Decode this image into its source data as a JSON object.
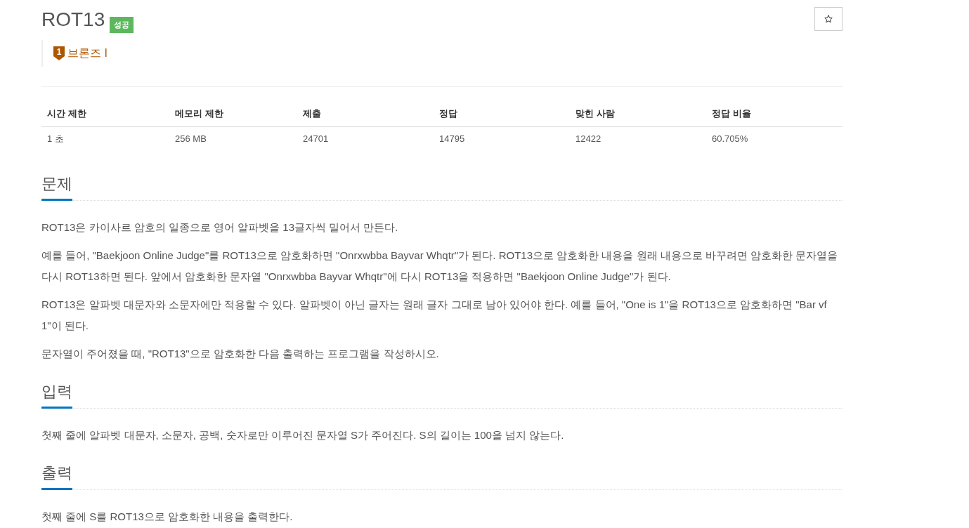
{
  "problem": {
    "title": "ROT13",
    "result_badge": "성공",
    "tier": {
      "number": "1",
      "label": "브론즈 I"
    }
  },
  "stats_table": {
    "columns": [
      "시간 제한",
      "메모리 제한",
      "제출",
      "정답",
      "맞힌 사람",
      "정답 비율"
    ],
    "rows": [
      [
        "1 초",
        "256 MB",
        "24701",
        "14795",
        "12422",
        "60.705%"
      ]
    ]
  },
  "sections": [
    {
      "heading": "문제",
      "paragraphs": [
        "ROT13은 카이사르 암호의 일종으로 영어 알파벳을 13글자씩 밀어서 만든다.",
        "예를 들어, \"Baekjoon Online Judge\"를 ROT13으로 암호화하면 \"Onrxwbba Bayvar Whqtr\"가 된다. ROT13으로 암호화한 내용을 원래 내용으로 바꾸려면 암호화한 문자열을 다시 ROT13하면 된다. 앞에서 암호화한 문자열 \"Onrxwbba Bayvar Whqtr\"에 다시 ROT13을 적용하면 \"Baekjoon Online Judge\"가 된다.",
        "ROT13은 알파벳 대문자와 소문자에만 적용할 수 있다. 알파벳이 아닌 글자는 원래 글자 그대로 남아 있어야 한다. 예를 들어, \"One is 1\"을 ROT13으로 암호화하면 \"Bar vf 1\"이 된다.",
        "문자열이 주어졌을 때, \"ROT13\"으로 암호화한 다음 출력하는 프로그램을 작성하시오."
      ]
    },
    {
      "heading": "입력",
      "paragraphs": [
        "첫째 줄에 알파벳 대문자, 소문자, 공백, 숫자로만 이루어진 문자열 S가 주어진다. S의 길이는 100을 넘지 않는다."
      ]
    },
    {
      "heading": "출력",
      "paragraphs": [
        "첫째 줄에 S를 ROT13으로 암호화한 내용을 출력한다."
      ]
    }
  ]
}
